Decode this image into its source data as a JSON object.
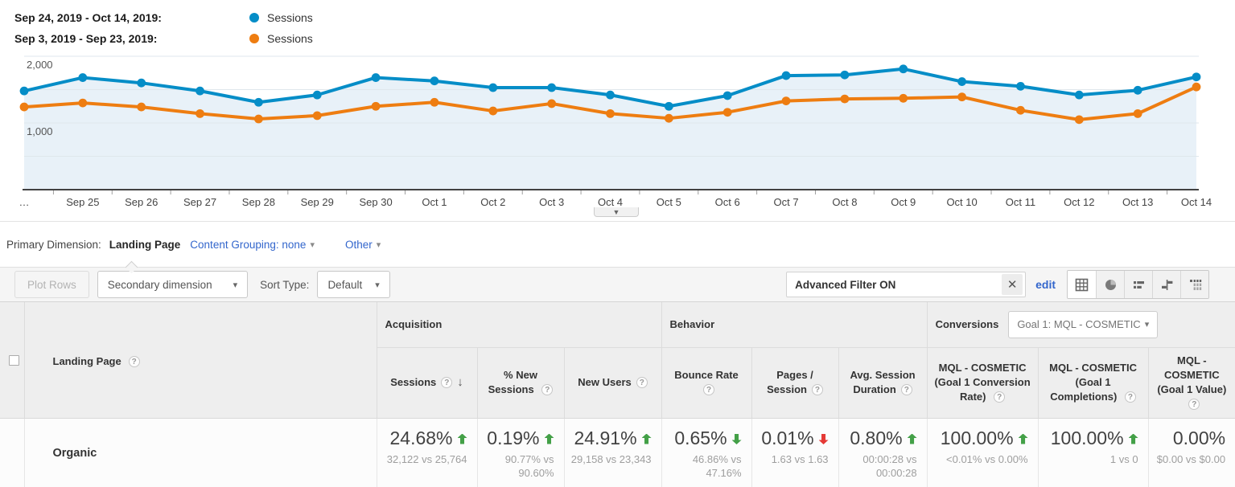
{
  "legend": {
    "rows": [
      {
        "label": "Sep 24, 2019 - Oct 14, 2019:",
        "series_label": "Sessions",
        "color": "#058dc7"
      },
      {
        "label": "Sep 3, 2019 - Sep 23, 2019:",
        "series_label": "Sessions",
        "color": "#ee7d11"
      }
    ]
  },
  "chart_data": {
    "type": "line",
    "title": "Sessions by day — current vs previous period",
    "x": [
      "…",
      "Sep 25",
      "Sep 26",
      "Sep 27",
      "Sep 28",
      "Sep 29",
      "Sep 30",
      "Oct 1",
      "Oct 2",
      "Oct 3",
      "Oct 4",
      "Oct 5",
      "Oct 6",
      "Oct 7",
      "Oct 8",
      "Oct 9",
      "Oct 10",
      "Oct 11",
      "Oct 12",
      "Oct 13",
      "Oct 14"
    ],
    "series": [
      {
        "name": "Sessions (Sep 24, 2019 - Oct 14, 2019)",
        "color": "#058dc7",
        "values": [
          1480,
          1680,
          1600,
          1480,
          1310,
          1420,
          1680,
          1630,
          1530,
          1530,
          1420,
          1250,
          1410,
          1710,
          1720,
          1810,
          1620,
          1550,
          1420,
          1490,
          1690
        ]
      },
      {
        "name": "Sessions (Sep 3, 2019 - Sep 23, 2019)",
        "color": "#ee7d11",
        "values": [
          1240,
          1300,
          1240,
          1140,
          1060,
          1110,
          1250,
          1310,
          1180,
          1290,
          1140,
          1070,
          1160,
          1330,
          1360,
          1370,
          1390,
          1190,
          1050,
          1140,
          1540
        ]
      }
    ],
    "ylim": [
      0,
      2100
    ],
    "yticks": [
      {
        "value": 1000,
        "label": "1,000"
      },
      {
        "value": 2000,
        "label": "2,000"
      }
    ],
    "grid_step": 500,
    "grid": true,
    "area_fill": "#e8f1f8",
    "legend_position": "top-left"
  },
  "dimension_bar": {
    "primary_label": "Primary Dimension:",
    "primary_value": "Landing Page",
    "content_grouping_label": "Content Grouping:",
    "content_grouping_value": "none",
    "other_label": "Other"
  },
  "toolbar": {
    "plot_rows_label": "Plot Rows",
    "secondary_dimension_label": "Secondary dimension",
    "sort_type_label": "Sort Type:",
    "sort_type_value": "Default",
    "filter_value": "Advanced Filter ON",
    "close_label": "✕",
    "edit_label": "edit",
    "view_buttons": [
      "data",
      "percentage",
      "performance",
      "comparison",
      "pivot"
    ],
    "active_view": "data"
  },
  "table": {
    "dimension_header": "Landing Page",
    "groups": [
      {
        "label": "Acquisition"
      },
      {
        "label": "Behavior"
      },
      {
        "label": "Conversions",
        "goal_selector": "Goal 1: MQL - COSMETIC"
      }
    ],
    "columns": [
      {
        "label": "Sessions",
        "sorted": "descending"
      },
      {
        "label": "% New Sessions"
      },
      {
        "label": "New Users"
      },
      {
        "label": "Bounce Rate"
      },
      {
        "label": "Pages / Session"
      },
      {
        "label": "Avg. Session Duration"
      },
      {
        "label": "MQL - COSMETIC (Goal 1 Conversion Rate)"
      },
      {
        "label": "MQL - COSMETIC (Goal 1 Completions)"
      },
      {
        "label": "MQL - COSMETIC (Goal 1 Value)"
      }
    ],
    "rows": [
      {
        "dimension": "Organic",
        "cells": [
          {
            "value": "24.68%",
            "dir": "up",
            "good": true,
            "sub": "32,122 vs 25,764"
          },
          {
            "value": "0.19%",
            "dir": "up",
            "good": true,
            "sub": "90.77% vs 90.60%"
          },
          {
            "value": "24.91%",
            "dir": "up",
            "good": true,
            "sub": "29,158 vs 23,343"
          },
          {
            "value": "0.65%",
            "dir": "down",
            "good": true,
            "sub": "46.86% vs 47.16%"
          },
          {
            "value": "0.01%",
            "dir": "down",
            "good": false,
            "sub": "1.63 vs 1.63"
          },
          {
            "value": "0.80%",
            "dir": "up",
            "good": true,
            "sub": "00:00:28 vs 00:00:28"
          },
          {
            "value": "100.00%",
            "dir": "up",
            "good": true,
            "sub": "<0.01% vs 0.00%"
          },
          {
            "value": "100.00%",
            "dir": "up",
            "good": true,
            "sub": "1 vs 0"
          },
          {
            "value": "0.00%",
            "dir": "none",
            "good": null,
            "sub": "$0.00 vs $0.00"
          }
        ]
      }
    ],
    "status_colors": {
      "positive": "#43a047",
      "negative": "#e53935"
    }
  }
}
